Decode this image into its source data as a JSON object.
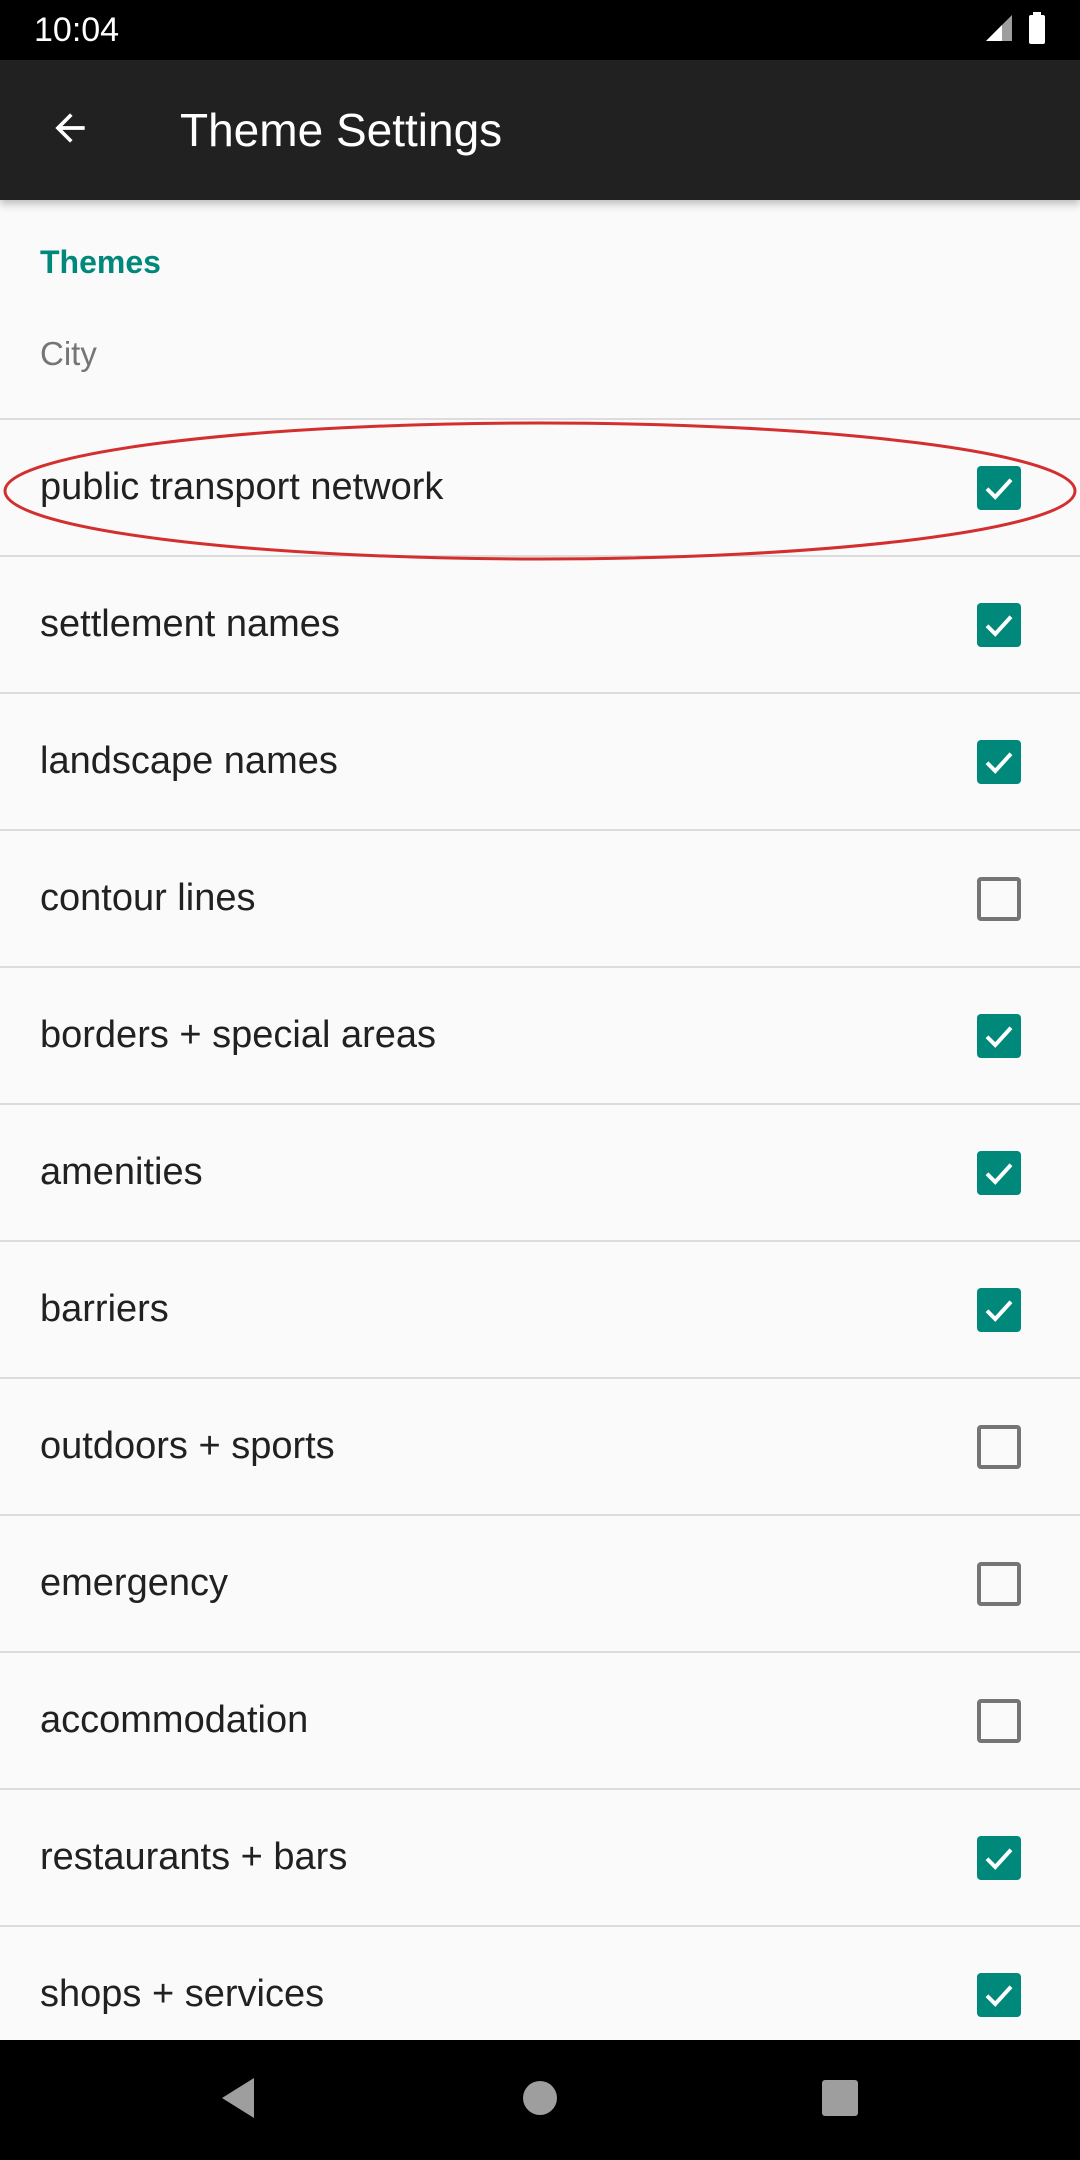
{
  "status_bar": {
    "time": "10:04",
    "icons": [
      "signal-icon",
      "battery-icon"
    ]
  },
  "app_bar": {
    "title": "Theme Settings",
    "back_icon": "arrow-back-icon"
  },
  "section": {
    "header": "Themes",
    "theme_value": "City"
  },
  "items": [
    {
      "label": "public transport network",
      "checked": true
    },
    {
      "label": "settlement names",
      "checked": true
    },
    {
      "label": "landscape names",
      "checked": true
    },
    {
      "label": "contour lines",
      "checked": false
    },
    {
      "label": "borders + special areas",
      "checked": true
    },
    {
      "label": "amenities",
      "checked": true
    },
    {
      "label": "barriers",
      "checked": true
    },
    {
      "label": "outdoors + sports",
      "checked": false
    },
    {
      "label": "emergency",
      "checked": false
    },
    {
      "label": "accommodation",
      "checked": false
    },
    {
      "label": "restaurants + bars",
      "checked": true
    },
    {
      "label": "shops + services",
      "checked": true
    }
  ],
  "nav_bar": {
    "buttons": [
      "back-triangle-icon",
      "home-circle-icon",
      "recents-square-icon"
    ]
  },
  "colors": {
    "accent": "#00897b",
    "app_bar": "#212121",
    "highlight": "#d32f2f"
  }
}
